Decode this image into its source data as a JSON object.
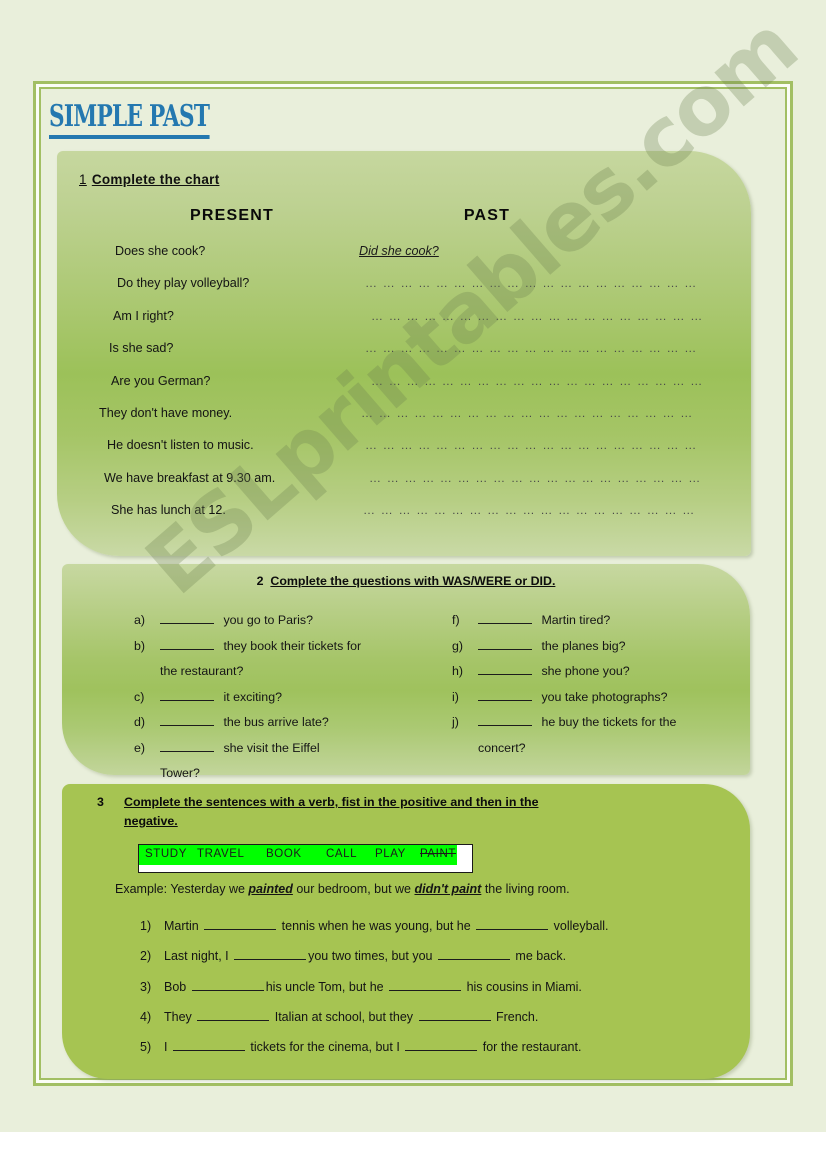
{
  "title": "SIMPLE PAST",
  "watermark": "ESLprintables.com",
  "accent_color": "#2478b0",
  "panel_green": "#9cc159",
  "highlight_color": "#00ff00",
  "ex1": {
    "number": "1",
    "heading": "Complete the chart",
    "col_present": "PRESENT",
    "col_past": "PAST",
    "dots": "… … … … … … … … … … … … … … … … … … …",
    "rows": [
      {
        "present": "Does she cook?",
        "past": "Did she cook?",
        "answered": true
      },
      {
        "present": "Do they play volleyball?",
        "past": "",
        "answered": false
      },
      {
        "present": "Am I right?",
        "past": "",
        "answered": false
      },
      {
        "present": "Is she sad?",
        "past": "",
        "answered": false
      },
      {
        "present": "Are you German?",
        "past": "",
        "answered": false
      },
      {
        "present": "They don't have money.",
        "past": "",
        "answered": false
      },
      {
        "present": "He doesn't listen to music.",
        "past": "",
        "answered": false
      },
      {
        "present": "We have breakfast at 9.30 am.",
        "past": "",
        "answered": false
      },
      {
        "present": "She has lunch at 12.",
        "past": "",
        "answered": false
      }
    ]
  },
  "ex2": {
    "number": "2",
    "heading": "Complete the questions with WAS/WERE or DID.",
    "left_items": [
      {
        "label": "a)",
        "text": "you go to Paris?",
        "wrap": ""
      },
      {
        "label": "b)",
        "text": "they book their tickets for",
        "wrap": "the restaurant?"
      },
      {
        "label": "c)",
        "text": "it exciting?",
        "wrap": ""
      },
      {
        "label": "d)",
        "text": "the bus arrive late?",
        "wrap": ""
      },
      {
        "label": "e)",
        "text": "she visit the Eiffel",
        "wrap": "Tower?"
      }
    ],
    "right_items": [
      {
        "label": "f)",
        "text": "Martin tired?",
        "wrap": ""
      },
      {
        "label": "g)",
        "text": "the planes big?",
        "wrap": ""
      },
      {
        "label": "h)",
        "text": "she phone you?",
        "wrap": ""
      },
      {
        "label": "i)",
        "text": "you take photographs?",
        "wrap": ""
      },
      {
        "label": "j)",
        "text": "he buy the tickets for the",
        "wrap": "concert?"
      }
    ]
  },
  "ex3": {
    "number": "3",
    "heading_line1": "Complete the sentences with a verb, fist in the positive and then in the",
    "heading_line2": "negative.",
    "verbs": [
      "STUDY",
      "TRAVEL",
      "BOOK",
      "CALL",
      "PLAY",
      "PAINT"
    ],
    "example_prefix": "Example: Yesterday we ",
    "example_verb1": "painted",
    "example_mid": " our bedroom, but we ",
    "example_verb2": "didn't paint",
    "example_suffix": " the living room.",
    "sentences": [
      {
        "label": "1)",
        "part1": "Martin ",
        "part2": " tennis when he was young, but he ",
        "part3": " volleyball."
      },
      {
        "label": "2)",
        "part1": "Last night, I ",
        "part2": "you two times, but you ",
        "part3": " me back."
      },
      {
        "label": "3)",
        "part1": "Bob ",
        "part2": "his uncle Tom, but he ",
        "part3": " his cousins in Miami."
      },
      {
        "label": "4)",
        "part1": "They ",
        "part2": " Italian at school, but they ",
        "part3": " French."
      },
      {
        "label": "5)",
        "part1": "I ",
        "part2": " tickets for the cinema, but I ",
        "part3": " for the restaurant."
      }
    ]
  }
}
